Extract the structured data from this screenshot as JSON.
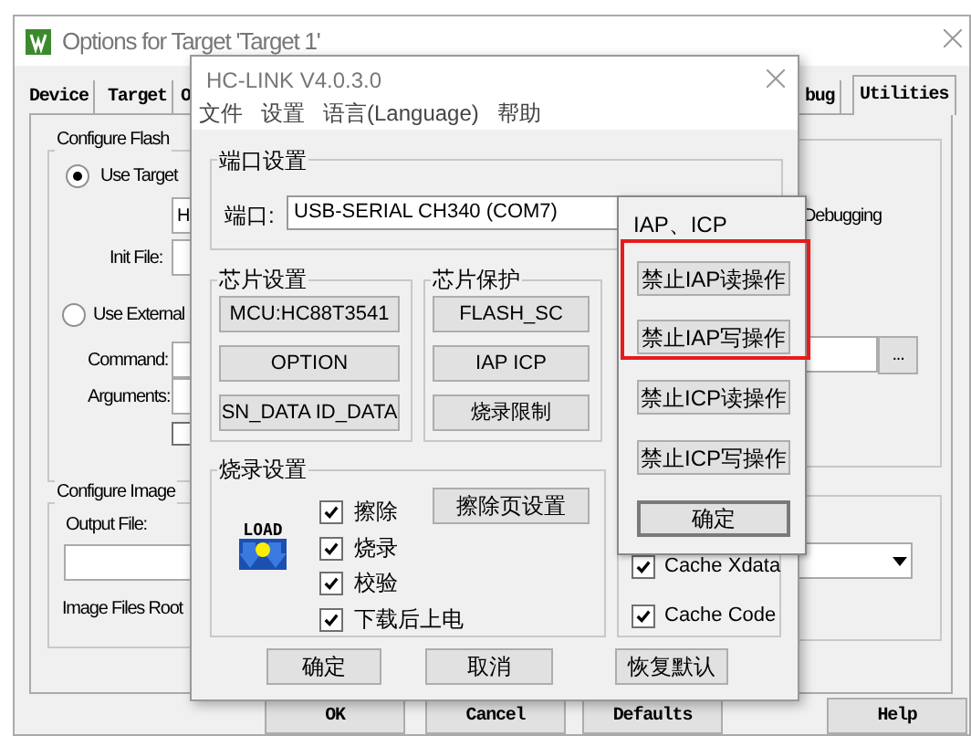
{
  "back_window": {
    "title": "Options for Target 'Target 1'",
    "tabs": [
      {
        "label": "Device",
        "selected": false
      },
      {
        "label": "Target",
        "selected": false
      },
      {
        "label": "O",
        "selected": false
      },
      {
        "label": "bug",
        "selected": false
      },
      {
        "label": "Utilities",
        "selected": true
      }
    ],
    "flash_group": {
      "legend": "Configure Flash",
      "options": [
        {
          "label": "Use Target",
          "selected": true
        },
        {
          "label": "Use External",
          "selected": false
        }
      ],
      "driver_field": {
        "value": "H"
      },
      "init_file_label": "Init File:",
      "command_label": "Command:",
      "arguments_label": "Arguments:",
      "checkbox": {
        "checked": false
      }
    },
    "debugging_label": "Debugging",
    "browse_button": "...",
    "image_group": {
      "legend": "Configure Image",
      "output_label": "Output File:",
      "root_label": "Image Files Root"
    },
    "buttons": [
      "OK",
      "Cancel",
      "Defaults",
      "Help"
    ]
  },
  "hc_link": {
    "title": "HC-LINK V4.0.3.0",
    "menu": [
      "文件",
      "设置",
      "语言(Language)",
      "帮助"
    ],
    "port_group": {
      "legend": "端口设置",
      "label": "端口:",
      "value": "USB-SERIAL CH340 (COM7)"
    },
    "chip_group": {
      "legend": "芯片设置",
      "buttons": [
        "MCU:HC88T3541",
        "OPTION",
        "SN_DATA ID_DATA"
      ]
    },
    "protect_group": {
      "legend": "芯片保护",
      "buttons": [
        "FLASH_SC",
        "IAP ICP",
        "烧录限制"
      ]
    },
    "burn_group": {
      "legend": "烧录设置",
      "icon_text": "LOAD",
      "options": [
        {
          "label": "擦除",
          "checked": true
        },
        {
          "label": "烧录",
          "checked": true
        },
        {
          "label": "校验",
          "checked": true
        },
        {
          "label": "下载后上电",
          "checked": true
        }
      ],
      "erase_page_button": "擦除页设置"
    },
    "cache_group": {
      "options": [
        {
          "label": "Cache Xdata",
          "checked": true
        },
        {
          "label": "Cache Code",
          "checked": true
        }
      ]
    },
    "buttons": [
      "确定",
      "取消",
      "恢复默认"
    ]
  },
  "popup": {
    "title": "IAP、ICP",
    "buttons": [
      "禁止IAP读操作",
      "禁止IAP写操作",
      "禁止ICP读操作",
      "禁止ICP写操作"
    ],
    "confirm": "确定"
  }
}
